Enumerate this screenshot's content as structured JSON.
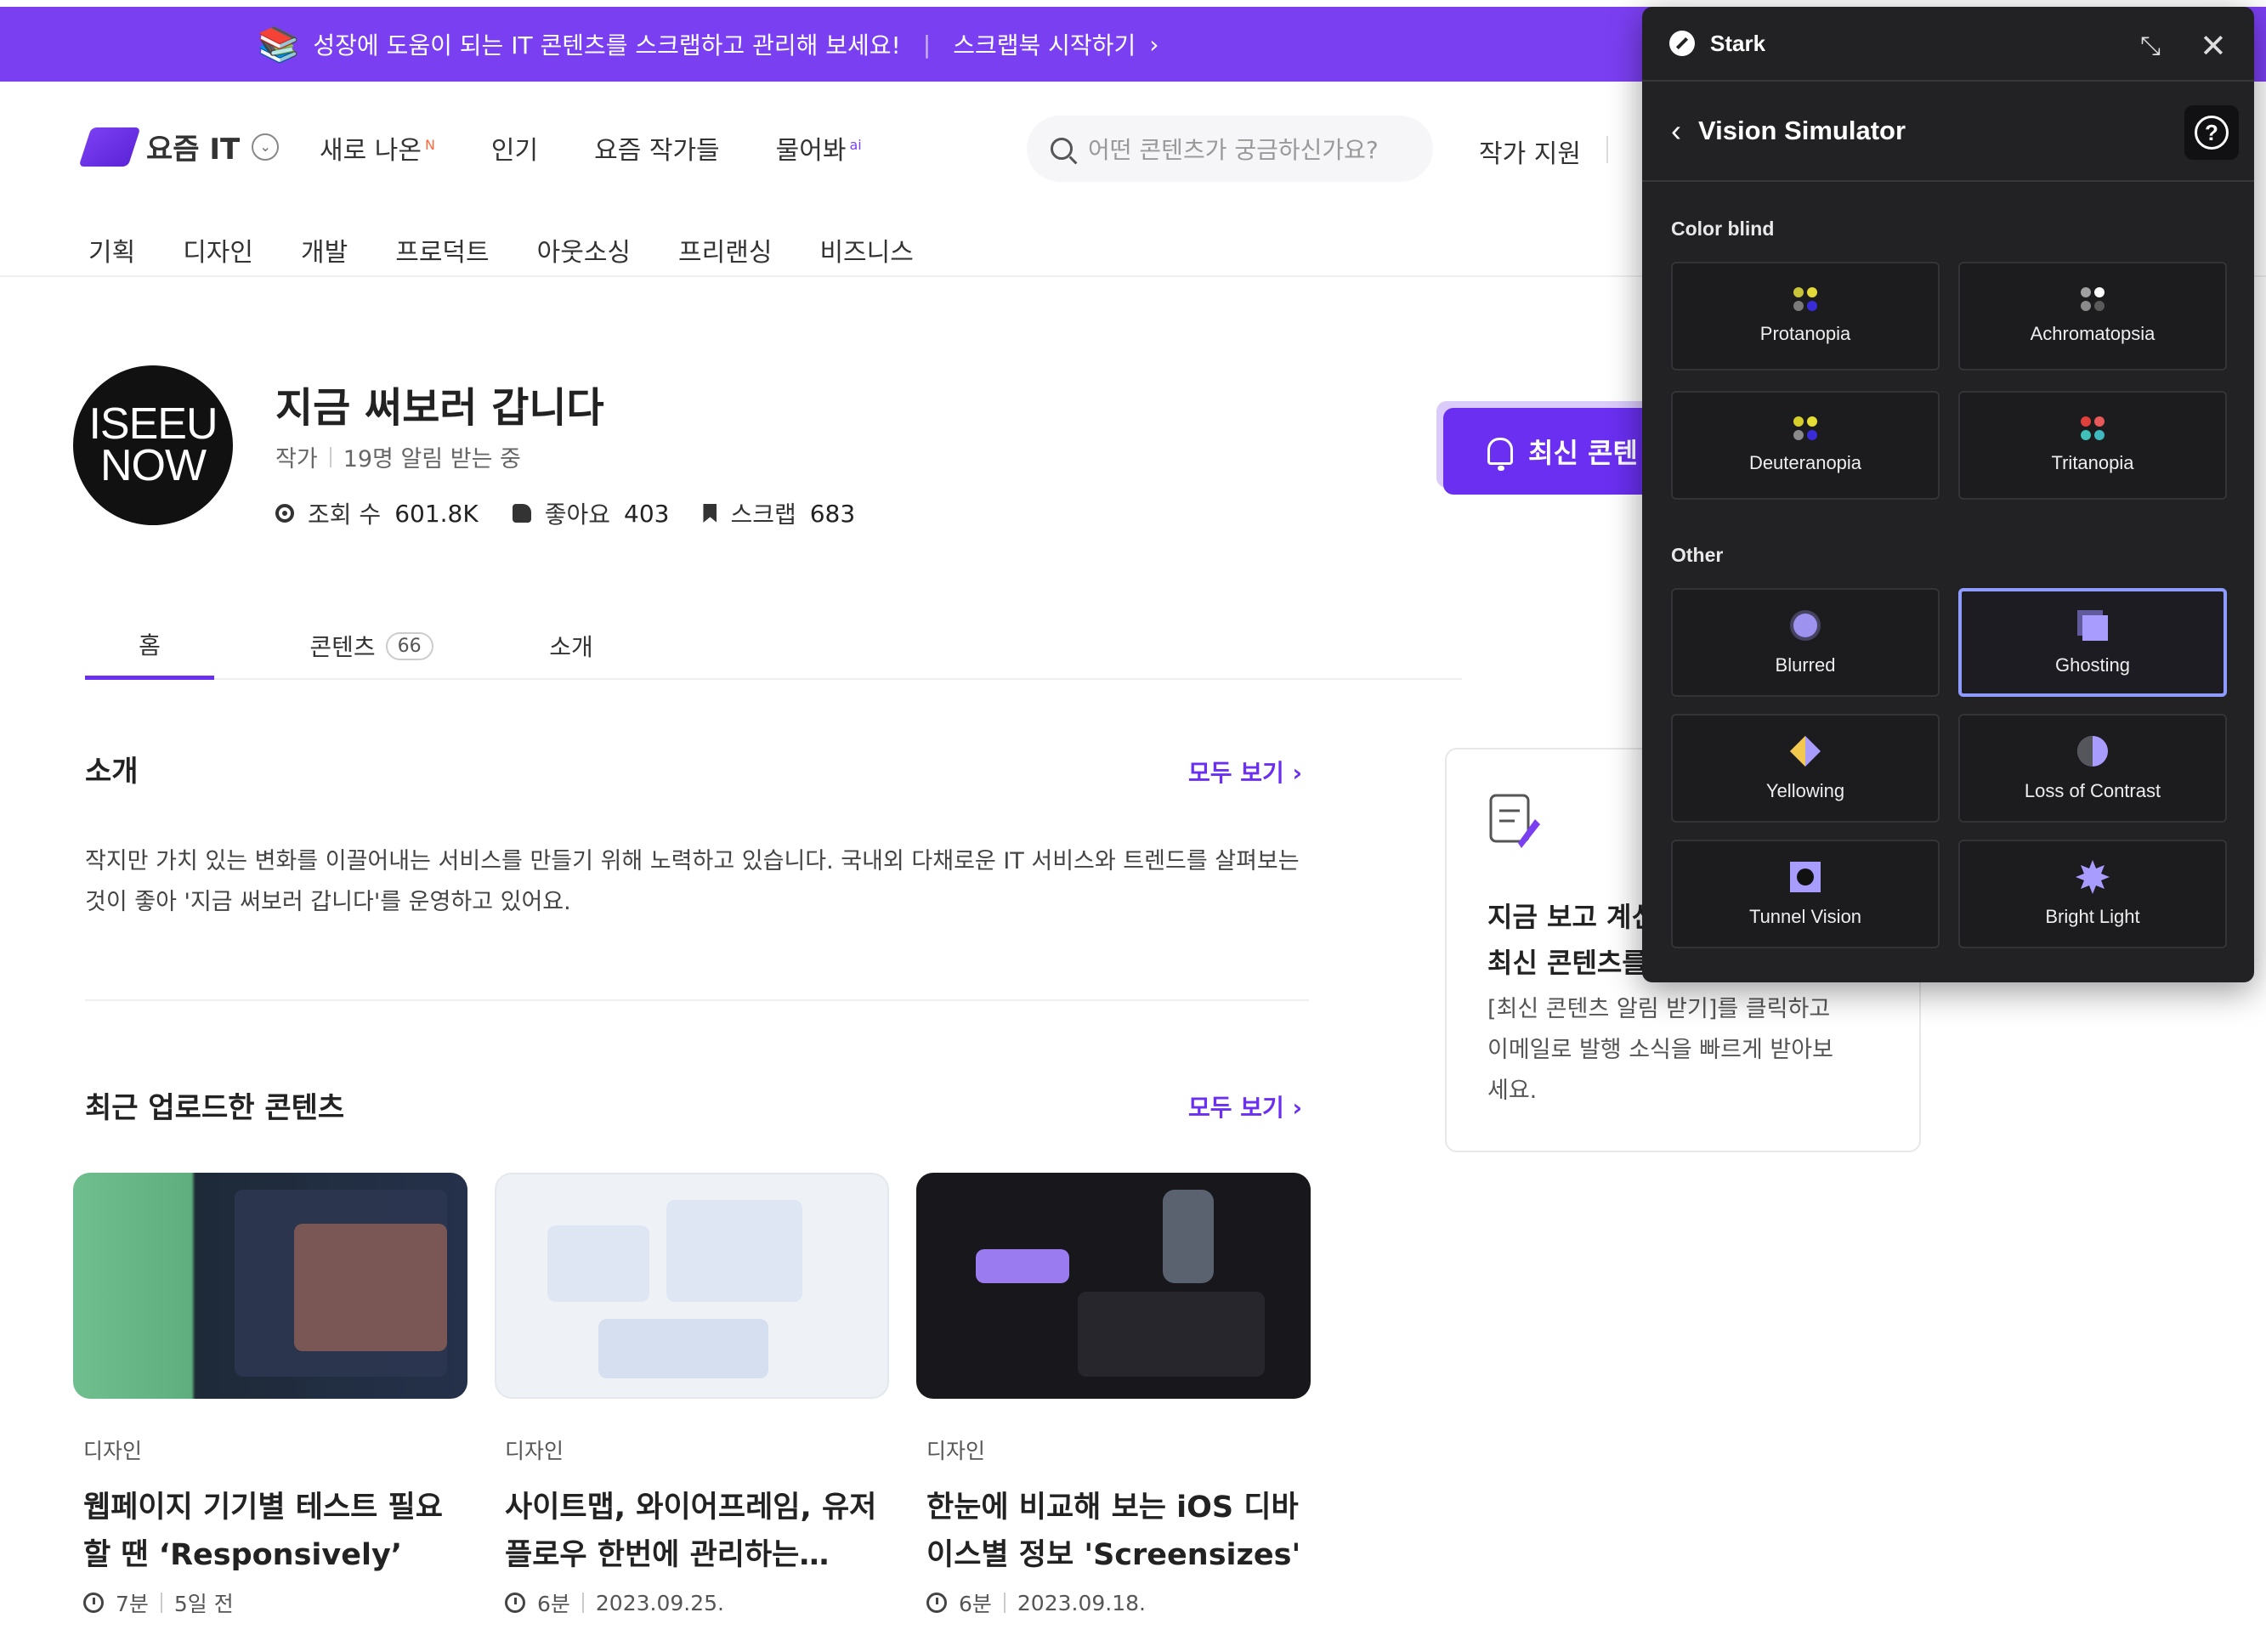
{
  "banner": {
    "message": "성장에 도움이 되는 IT 콘텐츠를 스크랩하고 관리해 보세요!",
    "cta": "스크랩북 시작하기",
    "emoji": "📚"
  },
  "header": {
    "logo_text": "요즘 IT",
    "nav": [
      {
        "label": "새로 나온",
        "badge": "N"
      },
      {
        "label": "인기",
        "badge": ""
      },
      {
        "label": "요즘 작가들",
        "badge": ""
      },
      {
        "label": "물어봐",
        "badge": "ai"
      }
    ],
    "search_placeholder": "어떤 콘텐츠가 궁금하신가요?",
    "author_support": "작가 지원",
    "categories": [
      "기획",
      "디자인",
      "개발",
      "프로덕트",
      "아웃소싱",
      "프리랜싱",
      "비즈니스"
    ]
  },
  "profile": {
    "avatar_text": [
      "ISEEU",
      "NOW"
    ],
    "name": "지금 써보러 갑니다",
    "role": "작가",
    "subscribers": "19명 알림 받는 중",
    "stats": [
      {
        "label": "조회 수",
        "value": "601.8K",
        "icon": "eye-icon"
      },
      {
        "label": "좋아요",
        "value": "403",
        "icon": "thumb-up-icon"
      },
      {
        "label": "스크랩",
        "value": "683",
        "icon": "bookmark-icon"
      }
    ],
    "subscribe_button": "최신 콘텐"
  },
  "tabs": [
    {
      "label": "홈",
      "active": true
    },
    {
      "label": "콘텐츠",
      "count": "66"
    },
    {
      "label": "소개"
    }
  ],
  "intro": {
    "title": "소개",
    "see_all": "모두 보기",
    "text": "작지만 가치 있는 변화를 이끌어내는 서비스를 만들기 위해 노력하고 있습니다. 국내외 다채로운 IT 서비스와 트렌드를 살펴보는 것이 좋아 '지금 써보러 갑니다'를 운영하고 있어요."
  },
  "side_card": {
    "title_line1": "지금 보고 계신",
    "title_line2": "최신 콘텐츠를",
    "desc": "[최신 콘텐츠 알림 받기]를 클릭하고 이메일로 발행 소식을 빠르게 받아보세요."
  },
  "recent": {
    "title": "최근 업로드한 콘텐츠",
    "see_all": "모두 보기",
    "cards": [
      {
        "category": "디자인",
        "title": "웹페이지 기기별 테스트 필요할 땐 ‘Responsively’",
        "read_time": "7분",
        "date": "5일 전"
      },
      {
        "category": "디자인",
        "title": "사이트맵, 와이어프레임, 유저 플로우 한번에 관리하는…",
        "read_time": "6분",
        "date": "2023.09.25."
      },
      {
        "category": "디자인",
        "title": "한눈에 비교해 보는 iOS 디바이스별 정보 'Screensizes'",
        "read_time": "6분",
        "date": "2023.09.18."
      }
    ]
  },
  "stark": {
    "app_name": "Stark",
    "panel_title": "Vision Simulator",
    "groups": [
      {
        "label": "Color blind",
        "items": [
          {
            "label": "Protanopia",
            "dots": [
              "#c8c43a",
              "#e3d93a",
              "#7a7a7a",
              "#3a2cd8"
            ]
          },
          {
            "label": "Achromatopsia",
            "dots": [
              "#a0a0a0",
              "#ffffff",
              "#8a8a8a",
              "#5a5a5a"
            ]
          },
          {
            "label": "Deuteranopia",
            "dots": [
              "#d6cf2b",
              "#e6dd35",
              "#8a8a8a",
              "#3a2cd8"
            ]
          },
          {
            "label": "Tritanopia",
            "dots": [
              "#e0403c",
              "#e85a5a",
              "#3fbfb8",
              "#3fb8c0"
            ]
          }
        ]
      },
      {
        "label": "Other",
        "items": [
          {
            "label": "Blurred"
          },
          {
            "label": "Ghosting",
            "selected": true
          },
          {
            "label": "Yellowing"
          },
          {
            "label": "Loss of Contrast"
          },
          {
            "label": "Tunnel Vision"
          },
          {
            "label": "Bright Light"
          }
        ]
      }
    ]
  },
  "colors": {
    "brand": "#6a2ff0",
    "banner": "#7b3ff2",
    "stark_bg": "#222225",
    "selected_border": "#8f9cff"
  }
}
